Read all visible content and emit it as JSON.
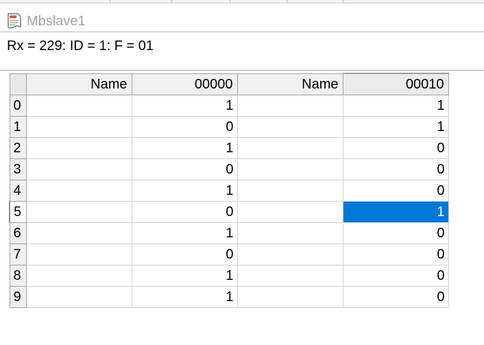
{
  "window": {
    "title": "Mbslave1"
  },
  "status": {
    "text": "Rx = 229: ID = 1: F = 01"
  },
  "grid": {
    "columns": [
      "Name",
      "00000",
      "Name",
      "00010"
    ],
    "rows": [
      {
        "index": "0",
        "name1": "",
        "v1": "1",
        "name2": "",
        "v2": "1"
      },
      {
        "index": "1",
        "name1": "",
        "v1": "0",
        "name2": "",
        "v2": "1"
      },
      {
        "index": "2",
        "name1": "",
        "v1": "1",
        "name2": "",
        "v2": "0"
      },
      {
        "index": "3",
        "name1": "",
        "v1": "0",
        "name2": "",
        "v2": "0"
      },
      {
        "index": "4",
        "name1": "",
        "v1": "1",
        "name2": "",
        "v2": "0"
      },
      {
        "index": "5",
        "name1": "",
        "v1": "0",
        "name2": "",
        "v2": "1"
      },
      {
        "index": "6",
        "name1": "",
        "v1": "1",
        "name2": "",
        "v2": "0"
      },
      {
        "index": "7",
        "name1": "",
        "v1": "0",
        "name2": "",
        "v2": "0"
      },
      {
        "index": "8",
        "name1": "",
        "v1": "1",
        "name2": "",
        "v2": "0"
      },
      {
        "index": "9",
        "name1": "",
        "v1": "1",
        "name2": "",
        "v2": "0"
      }
    ],
    "selected_row": 5,
    "selected_column": 3,
    "selection_color": "#0078d7"
  }
}
